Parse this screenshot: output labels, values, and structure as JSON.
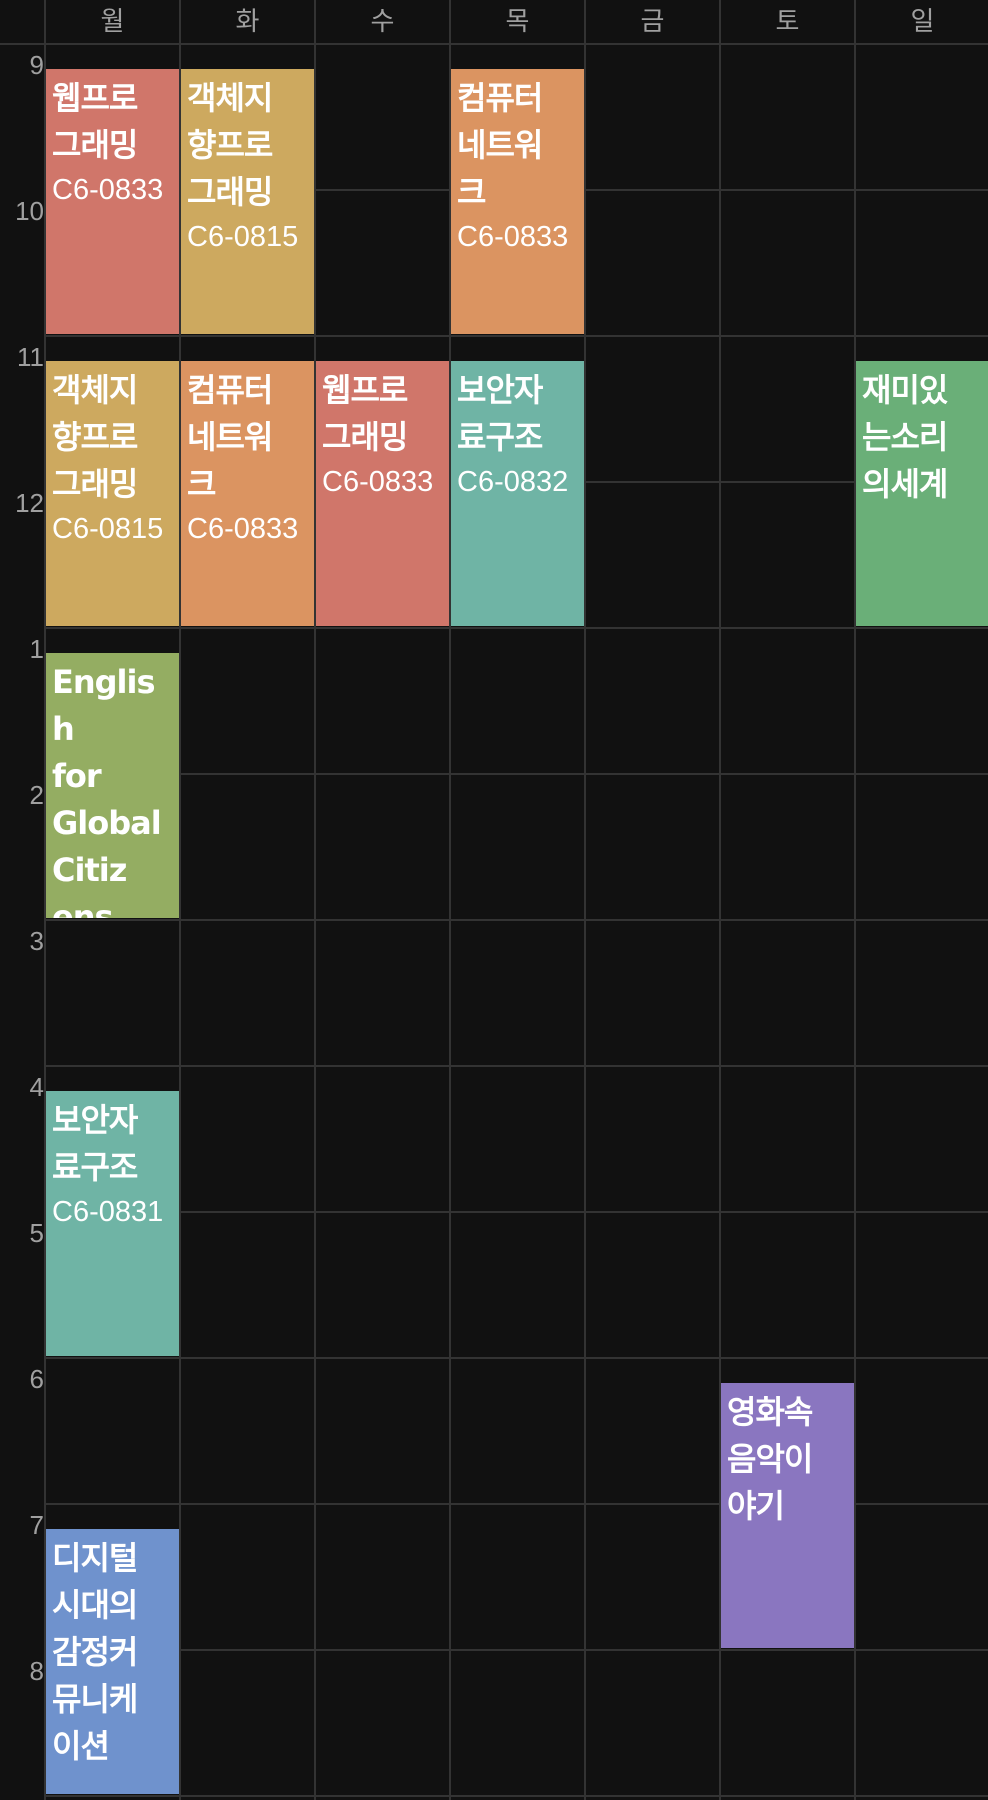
{
  "days": [
    "월",
    "화",
    "수",
    "목",
    "금",
    "토",
    "일"
  ],
  "hours": [
    "9",
    "10",
    "11",
    "12",
    "1",
    "2",
    "3",
    "4",
    "5",
    "6",
    "7",
    "8"
  ],
  "colors": {
    "background": "#111111",
    "grid": "#333333",
    "label": "#a0a0a0",
    "red": "#d0766a",
    "mustard": "#cda95f",
    "orange": "#db9461",
    "teal": "#6fb4a5",
    "green": "#6aaf78",
    "olive": "#94ad62",
    "purple": "#8a76c0",
    "blue": "#6f92cd"
  },
  "courses": [
    {
      "day": 0,
      "start": 9,
      "end": 11,
      "title": "웹프로\n그래밍",
      "room": "C6-0833",
      "color": "red"
    },
    {
      "day": 1,
      "start": 9,
      "end": 11,
      "title": "객체지\n향프로\n그래밍",
      "room": "C6-0815",
      "color": "mustard"
    },
    {
      "day": 3,
      "start": 9,
      "end": 11,
      "title": "컴퓨터\n네트워\n크",
      "room": "C6-0833",
      "color": "orange"
    },
    {
      "day": 0,
      "start": 11,
      "end": 13,
      "title": "객체지\n향프로\n그래밍",
      "room": "C6-0815",
      "color": "mustard"
    },
    {
      "day": 1,
      "start": 11,
      "end": 13,
      "title": "컴퓨터\n네트워\n크",
      "room": "C6-0833",
      "color": "orange"
    },
    {
      "day": 2,
      "start": 11,
      "end": 13,
      "title": "웹프로\n그래밍",
      "room": "C6-0833",
      "color": "red"
    },
    {
      "day": 3,
      "start": 11,
      "end": 13,
      "title": "보안자\n료구조",
      "room": "C6-0832",
      "color": "teal"
    },
    {
      "day": 6,
      "start": 11,
      "end": 13,
      "title": "재미있\n는소리\n의세계",
      "room": "",
      "color": "green"
    },
    {
      "day": 0,
      "start": 13,
      "end": 15,
      "title": "English\nfor\nGlobal\nCitiz\nens\nIII",
      "room": "",
      "color": "olive"
    },
    {
      "day": 0,
      "start": 16,
      "end": 18,
      "title": "보안자\n료구조",
      "room": "C6-0831",
      "color": "teal"
    },
    {
      "day": 5,
      "start": 18,
      "end": 20,
      "title": "영화속\n음악이\n야기",
      "room": "",
      "color": "purple"
    },
    {
      "day": 0,
      "start": 19,
      "end": 21,
      "title": "디지털\n시대의\n감정커\n뮤니케\n이션",
      "room": "",
      "color": "blue"
    }
  ]
}
